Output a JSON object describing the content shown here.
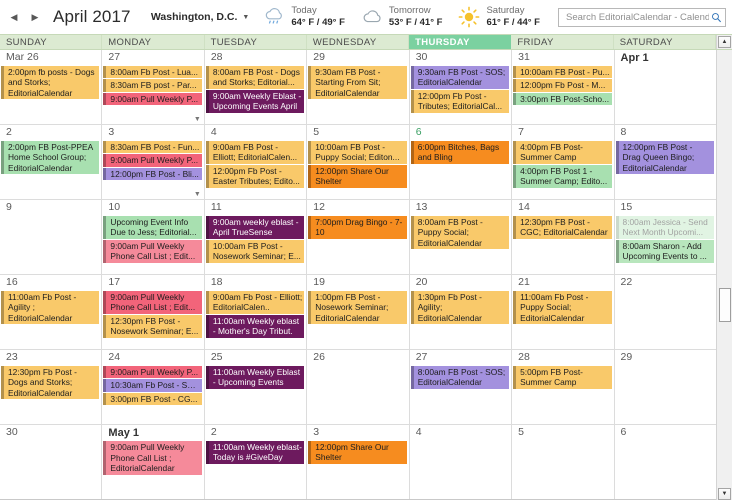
{
  "header": {
    "prev_label": "◀",
    "next_label": "▶",
    "month_title": "April 2017",
    "location": "Washington, D.C.",
    "location_caret": "▼",
    "weather": [
      {
        "icon": "rain-cloud-icon",
        "label": "Today",
        "temp": "64° F / 49° F"
      },
      {
        "icon": "cloud-icon",
        "label": "Tomorrow",
        "temp": "53° F / 41° F"
      },
      {
        "icon": "sun-icon",
        "label": "Saturday",
        "temp": "61° F / 44° F"
      }
    ],
    "search_placeholder": "Search EditorialCalendar - Calendar ..."
  },
  "daynames": [
    {
      "label": "SUNDAY",
      "today": false
    },
    {
      "label": "MONDAY",
      "today": false
    },
    {
      "label": "TUESDAY",
      "today": false
    },
    {
      "label": "WEDNESDAY",
      "today": false
    },
    {
      "label": "THURSDAY",
      "today": true
    },
    {
      "label": "FRIDAY",
      "today": false
    },
    {
      "label": "SATURDAY",
      "today": false
    }
  ],
  "scrollbar": {
    "up_arrow": "▲",
    "down_arrow": "▼"
  },
  "weeks": [
    {
      "days": [
        {
          "num": "Mar 26",
          "bold": false,
          "today": false,
          "overflow": false,
          "events": [
            {
              "text": "2:00pm fb posts - Dogs and Storks; EditorialCalendar",
              "color": "c-orange",
              "lines": 3
            }
          ]
        },
        {
          "num": "27",
          "bold": false,
          "today": false,
          "overflow": true,
          "events": [
            {
              "text": "8:00am Fb Post - Lua...",
              "color": "c-orange",
              "lines": 1
            },
            {
              "text": "8:30am FB post - Par...",
              "color": "c-orange",
              "lines": 1
            },
            {
              "text": "9:00am Pull Weekly P...",
              "color": "c-pink",
              "lines": 1
            }
          ]
        },
        {
          "num": "28",
          "bold": false,
          "today": false,
          "overflow": false,
          "events": [
            {
              "text": "8:00am FB Post - Dogs and Storks; Editorial...",
              "color": "c-orange",
              "lines": 2
            },
            {
              "text": "9:00am Weekly Eblast - Upcoming Events April",
              "color": "c-dpurple",
              "lines": 2,
              "white": true
            }
          ]
        },
        {
          "num": "29",
          "bold": false,
          "today": false,
          "overflow": false,
          "events": [
            {
              "text": "9:30am FB Post - Starting From Sit; EditorialCalendar",
              "color": "c-orange",
              "lines": 3
            }
          ]
        },
        {
          "num": "30",
          "bold": false,
          "today": false,
          "overflow": false,
          "events": [
            {
              "text": "9:30am FB Post - SOS; EditorialCalendar",
              "color": "c-purple",
              "lines": 2
            },
            {
              "text": "12:00pm Fb Post - Tributes; EditorialCal...",
              "color": "c-orange",
              "lines": 2
            }
          ]
        },
        {
          "num": "31",
          "bold": false,
          "today": false,
          "overflow": false,
          "events": [
            {
              "text": "10:00am FB Post - Pu...",
              "color": "c-orange",
              "lines": 1
            },
            {
              "text": "12:00pm Fb Post - M...",
              "color": "c-orange",
              "lines": 1
            },
            {
              "text": "3:00pm FB Post-Scho...",
              "color": "c-green",
              "lines": 1
            }
          ]
        },
        {
          "num": "Apr 1",
          "bold": true,
          "today": false,
          "overflow": false,
          "events": []
        }
      ]
    },
    {
      "days": [
        {
          "num": "2",
          "bold": false,
          "today": false,
          "overflow": false,
          "events": [
            {
              "text": "2:00pm FB Post-PPEA Home School Group; EditorialCalendar",
              "color": "c-green",
              "lines": 3
            }
          ]
        },
        {
          "num": "3",
          "bold": false,
          "today": false,
          "overflow": true,
          "events": [
            {
              "text": "8:30am FB Post - Fun...",
              "color": "c-orange",
              "lines": 1
            },
            {
              "text": "9:00am Pull Weekly P...",
              "color": "c-pink",
              "lines": 1
            },
            {
              "text": "12:00pm FB Post - Bli...",
              "color": "c-purple",
              "lines": 1
            }
          ]
        },
        {
          "num": "4",
          "bold": false,
          "today": false,
          "overflow": false,
          "events": [
            {
              "text": "9:00am FB Post - Elliott; EditorialCalen...",
              "color": "c-orange",
              "lines": 2
            },
            {
              "text": "12:00pm Fb Post - Easter Tributes; Edito...",
              "color": "c-orange",
              "lines": 2
            }
          ]
        },
        {
          "num": "5",
          "bold": false,
          "today": false,
          "overflow": false,
          "events": [
            {
              "text": "10:00am FB Post - Puppy Social; Editon...",
              "color": "c-orange",
              "lines": 2
            },
            {
              "text": "12:00pm Share Our Shelter",
              "color": "c-dorange",
              "lines": 2
            }
          ]
        },
        {
          "num": "6",
          "bold": false,
          "today": true,
          "overflow": false,
          "events": [
            {
              "text": "6:00pm Bitches, Bags and Bling",
              "color": "c-dorange",
              "lines": 2
            }
          ]
        },
        {
          "num": "7",
          "bold": false,
          "today": false,
          "overflow": false,
          "events": [
            {
              "text": "4:00pm FB Post-Summer Camp",
              "color": "c-orange",
              "lines": 2
            },
            {
              "text": "4:00pm FB Post 1 - Summer Camp; Edito...",
              "color": "c-green",
              "lines": 2
            }
          ]
        },
        {
          "num": "8",
          "bold": false,
          "today": false,
          "overflow": false,
          "events": [
            {
              "text": "12:00pm FB Post - Drag Queen Bingo; EditorialCalendar",
              "color": "c-purple",
              "lines": 3
            }
          ]
        }
      ]
    },
    {
      "days": [
        {
          "num": "9",
          "bold": false,
          "today": false,
          "overflow": false,
          "events": []
        },
        {
          "num": "10",
          "bold": false,
          "today": false,
          "overflow": false,
          "events": [
            {
              "text": "Upcoming Event Info Due to Jess; Editorial...",
              "color": "c-green",
              "lines": 2
            },
            {
              "text": "9:00am Pull Weekly Phone Call List ; Edit...",
              "color": "c-lpink",
              "lines": 2
            }
          ]
        },
        {
          "num": "11",
          "bold": false,
          "today": false,
          "overflow": false,
          "events": [
            {
              "text": "9:00am weekly eblast - April TrueSense",
              "color": "c-dpurple",
              "lines": 2,
              "white": true
            },
            {
              "text": "10:00am FB Post - Nosework Seminar; E...",
              "color": "c-orange",
              "lines": 2
            }
          ]
        },
        {
          "num": "12",
          "bold": false,
          "today": false,
          "overflow": false,
          "events": [
            {
              "text": "7:00pm Drag Bingo - 7-10",
              "color": "c-dorange",
              "lines": 2
            }
          ]
        },
        {
          "num": "13",
          "bold": false,
          "today": false,
          "overflow": false,
          "events": [
            {
              "text": "8:00am FB Post - Puppy Social; EditorialCalendar",
              "color": "c-orange",
              "lines": 3
            }
          ]
        },
        {
          "num": "14",
          "bold": false,
          "today": false,
          "overflow": false,
          "events": [
            {
              "text": "12:30pm FB Post - CGC; EditorialCalendar",
              "color": "c-orange",
              "lines": 2
            }
          ]
        },
        {
          "num": "15",
          "bold": false,
          "today": false,
          "overflow": false,
          "events": [
            {
              "text": "8:00am Jessica - Send Next Month Upcomi...",
              "color": "c-lgreen",
              "lines": 2,
              "pale": true
            },
            {
              "text": "8:00am Sharon - Add Upcoming Events to ...",
              "color": "c-lgreen",
              "lines": 2
            }
          ]
        }
      ]
    },
    {
      "days": [
        {
          "num": "16",
          "bold": false,
          "today": false,
          "overflow": false,
          "events": [
            {
              "text": "11:00am Fb Post - Agility ; EditorialCalendar",
              "color": "c-orange",
              "lines": 3
            }
          ]
        },
        {
          "num": "17",
          "bold": false,
          "today": false,
          "overflow": false,
          "events": [
            {
              "text": "9:00am Pull Weekly Phone Call List ; Edit...",
              "color": "c-pink",
              "lines": 2
            },
            {
              "text": "12:30pm FB Post - Nosework Seminar; E...",
              "color": "c-orange",
              "lines": 2
            }
          ]
        },
        {
          "num": "18",
          "bold": false,
          "today": false,
          "overflow": false,
          "events": [
            {
              "text": "9:00am Fb Post - Elliott; EditorialCalen..",
              "color": "c-orange",
              "lines": 2
            },
            {
              "text": "11:00am Weekly eblast - Mother's Day Tribut.",
              "color": "c-dpurple",
              "lines": 2,
              "white": true
            }
          ]
        },
        {
          "num": "19",
          "bold": false,
          "today": false,
          "overflow": false,
          "events": [
            {
              "text": "1:00pm FB Post - Nosework Seminar; EditorialCalendar",
              "color": "c-orange",
              "lines": 3
            }
          ]
        },
        {
          "num": "20",
          "bold": false,
          "today": false,
          "overflow": false,
          "events": [
            {
              "text": "1:30pm Fb Post - Agility; EditorialCalendar",
              "color": "c-orange",
              "lines": 3
            }
          ]
        },
        {
          "num": "21",
          "bold": false,
          "today": false,
          "overflow": false,
          "events": [
            {
              "text": "11:00am Fb Post -Puppy Social; EditorialCalendar",
              "color": "c-orange",
              "lines": 3
            }
          ]
        },
        {
          "num": "22",
          "bold": false,
          "today": false,
          "overflow": false,
          "events": []
        }
      ]
    },
    {
      "days": [
        {
          "num": "23",
          "bold": false,
          "today": false,
          "overflow": false,
          "events": [
            {
              "text": "12:30pm Fb Post - Dogs and Storks; EditorialCalendar",
              "color": "c-orange",
              "lines": 3
            }
          ]
        },
        {
          "num": "24",
          "bold": false,
          "today": false,
          "overflow": false,
          "events": [
            {
              "text": "9:00am Pull Weekly P...",
              "color": "c-pink",
              "lines": 1
            },
            {
              "text": "10:30am Fb Post - SO...",
              "color": "c-purple",
              "lines": 1
            },
            {
              "text": "3:00pm FB Post - CG...",
              "color": "c-orange",
              "lines": 1
            }
          ]
        },
        {
          "num": "25",
          "bold": false,
          "today": false,
          "overflow": false,
          "events": [
            {
              "text": "11:00am Weekly Eblast - Upcoming Events",
              "color": "c-dpurple",
              "lines": 2,
              "white": true
            }
          ]
        },
        {
          "num": "26",
          "bold": false,
          "today": false,
          "overflow": false,
          "events": []
        },
        {
          "num": "27",
          "bold": false,
          "today": false,
          "overflow": false,
          "events": [
            {
              "text": "8:00am FB Post - SOS; EditorialCalendar",
              "color": "c-purple",
              "lines": 2
            }
          ]
        },
        {
          "num": "28",
          "bold": false,
          "today": false,
          "overflow": false,
          "events": [
            {
              "text": "5:00pm FB Post-Summer Camp",
              "color": "c-orange",
              "lines": 2
            }
          ]
        },
        {
          "num": "29",
          "bold": false,
          "today": false,
          "overflow": false,
          "events": []
        }
      ]
    },
    {
      "days": [
        {
          "num": "30",
          "bold": false,
          "today": false,
          "overflow": false,
          "events": []
        },
        {
          "num": "May 1",
          "bold": true,
          "today": false,
          "overflow": false,
          "events": [
            {
              "text": "9:00am Pull Weekly Phone Call List ; EditorialCalendar",
              "color": "c-lpink",
              "lines": 3
            }
          ]
        },
        {
          "num": "2",
          "bold": false,
          "today": false,
          "overflow": false,
          "events": [
            {
              "text": "11:00am Weekly eblast- Today is #GiveDay",
              "color": "c-dpurple",
              "lines": 3,
              "white": true
            }
          ]
        },
        {
          "num": "3",
          "bold": false,
          "today": false,
          "overflow": false,
          "events": [
            {
              "text": "12:00pm Share Our Shelter",
              "color": "c-dorange",
              "lines": 2
            }
          ]
        },
        {
          "num": "4",
          "bold": false,
          "today": false,
          "overflow": false,
          "events": []
        },
        {
          "num": "5",
          "bold": false,
          "today": false,
          "overflow": false,
          "events": []
        },
        {
          "num": "6",
          "bold": false,
          "today": false,
          "overflow": false,
          "events": []
        }
      ]
    }
  ]
}
